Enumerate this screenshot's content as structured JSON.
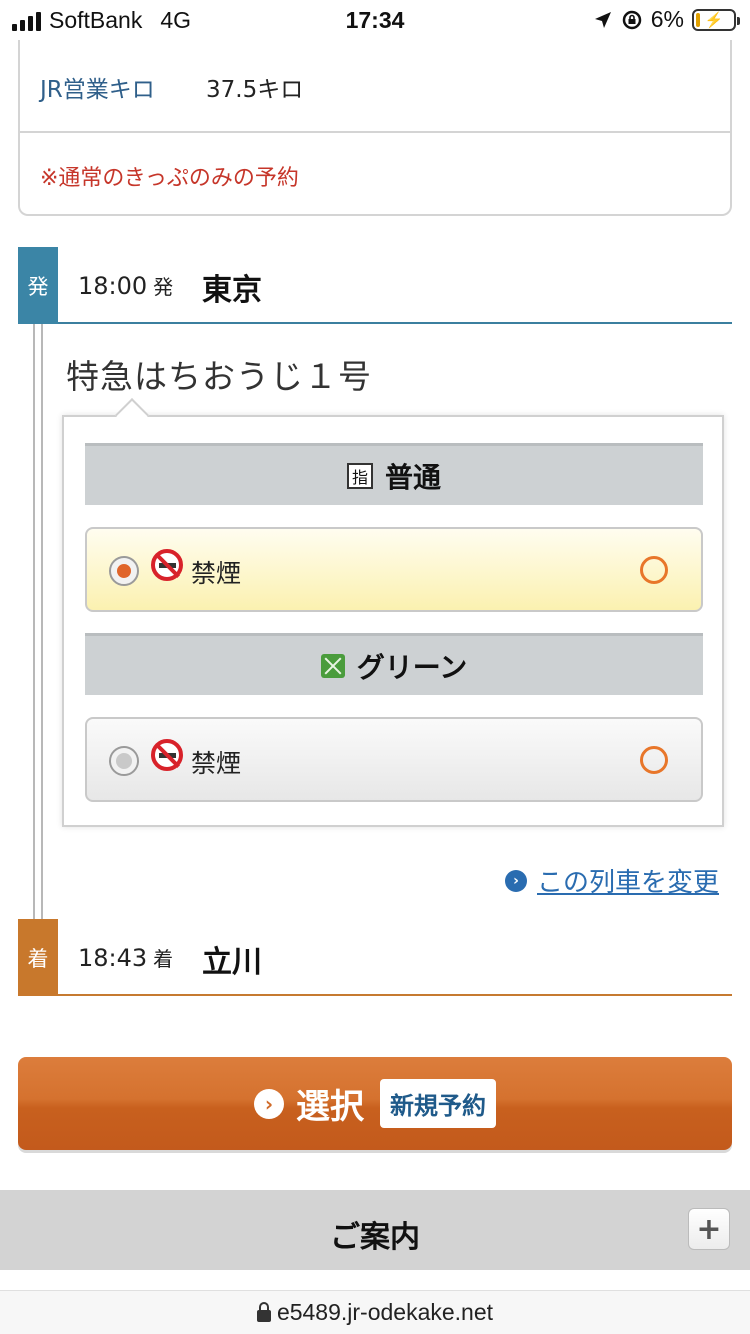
{
  "status_bar": {
    "carrier": "SoftBank",
    "network": "4G",
    "time": "17:34",
    "battery_percent": "6%"
  },
  "info": {
    "kilo_label": "JR営業キロ",
    "kilo_value": "37.5キロ",
    "note": "※通常のきっぷのみの予約"
  },
  "departure": {
    "tag": "発",
    "time": "18:00",
    "suffix": "発",
    "station": "東京"
  },
  "train": {
    "name": "特急はちおうじ１号"
  },
  "seat_classes": [
    {
      "icon_label": "指",
      "title": "普通",
      "option_label": "禁煙",
      "selected": true,
      "availability": "○"
    },
    {
      "title": "グリーン",
      "option_label": "禁煙",
      "selected": false,
      "availability": "○"
    }
  ],
  "change_link": "この列車を変更",
  "arrival": {
    "tag": "着",
    "time": "18:43",
    "suffix": "着",
    "station": "立川"
  },
  "select_button": {
    "label": "選択",
    "badge": "新規予約"
  },
  "guide": {
    "title": "ご案内",
    "expand": "+"
  },
  "url": "e5489.jr-odekake.net",
  "colors": {
    "depart_blue": "#3b85a6",
    "arrive_orange": "#c8782c",
    "button_orange": "#d06a28",
    "note_red": "#c6362a",
    "link_blue": "#2a6cb0"
  }
}
